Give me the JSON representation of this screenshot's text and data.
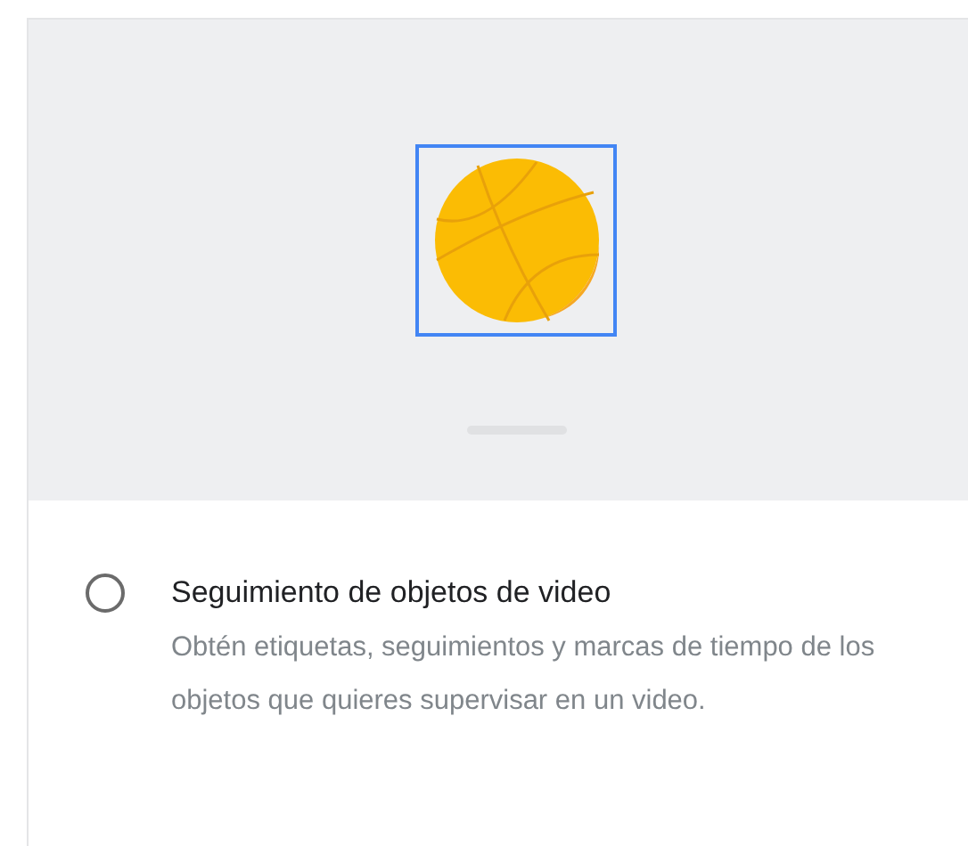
{
  "option": {
    "title": "Seguimiento de objetos de video",
    "description": "Obtén etiquetas, seguimientos y marcas de tiempo de los objetos que quieres supervisar en un video.",
    "selected": false
  }
}
